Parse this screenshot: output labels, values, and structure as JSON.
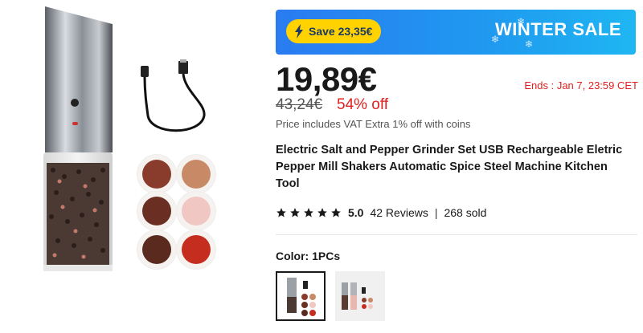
{
  "banner": {
    "save_text": "Save 23,35€",
    "sale_text": "WINTER SALE"
  },
  "price": {
    "current": "19,89€",
    "original": "43,24€",
    "discount": "54% off",
    "ends": "Ends :  Jan 7, 23:59 CET",
    "note": "Price includes VAT Extra 1% off with coins"
  },
  "product": {
    "title": "Electric Salt and Pepper Grinder Set USB Rechargeable Eletric Pepper Mill Shakers Automatic Spice Steel Machine Kitchen Tool"
  },
  "rating": {
    "stars": 5,
    "score": "5.0",
    "reviews": "42 Reviews",
    "sold": "268 sold",
    "separator": "|"
  },
  "color": {
    "label": "Color:",
    "selected": "1PCs"
  },
  "colors": {
    "accent_red": "#e02020",
    "banner_blue": "#2a7bf1",
    "pill_yellow": "#ffd200"
  }
}
